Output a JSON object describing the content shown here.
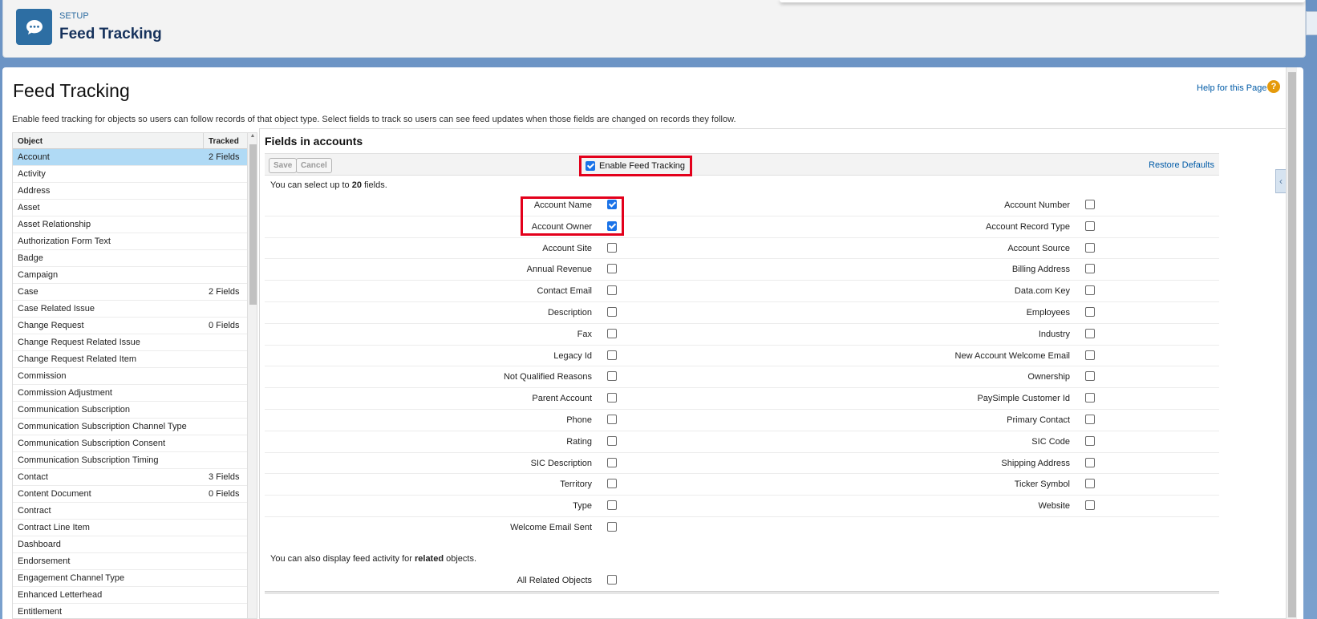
{
  "header": {
    "eyebrow": "SETUP",
    "title": "Feed Tracking",
    "icon": "chat-bubble-icon"
  },
  "page": {
    "title": "Feed Tracking",
    "help_label": "Help for this Page",
    "help_icon": "question-icon",
    "description": "Enable feed tracking for objects so users can follow records of that object type. Select fields to track so users can see feed updates when those fields are changed on records they follow."
  },
  "object_list": {
    "col_object": "Object",
    "col_tracked": "Tracked",
    "rows": [
      {
        "name": "Account",
        "tracked": "2 Fields",
        "selected": true
      },
      {
        "name": "Activity",
        "tracked": ""
      },
      {
        "name": "Address",
        "tracked": ""
      },
      {
        "name": "Asset",
        "tracked": ""
      },
      {
        "name": "Asset Relationship",
        "tracked": ""
      },
      {
        "name": "Authorization Form Text",
        "tracked": ""
      },
      {
        "name": "Badge",
        "tracked": ""
      },
      {
        "name": "Campaign",
        "tracked": ""
      },
      {
        "name": "Case",
        "tracked": "2 Fields"
      },
      {
        "name": "Case Related Issue",
        "tracked": ""
      },
      {
        "name": "Change Request",
        "tracked": "0 Fields"
      },
      {
        "name": "Change Request Related Issue",
        "tracked": ""
      },
      {
        "name": "Change Request Related Item",
        "tracked": ""
      },
      {
        "name": "Commission",
        "tracked": ""
      },
      {
        "name": "Commission Adjustment",
        "tracked": ""
      },
      {
        "name": "Communication Subscription",
        "tracked": ""
      },
      {
        "name": "Communication Subscription Channel Type",
        "tracked": ""
      },
      {
        "name": "Communication Subscription Consent",
        "tracked": ""
      },
      {
        "name": "Communication Subscription Timing",
        "tracked": ""
      },
      {
        "name": "Contact",
        "tracked": "3 Fields"
      },
      {
        "name": "Content Document",
        "tracked": "0 Fields"
      },
      {
        "name": "Contract",
        "tracked": ""
      },
      {
        "name": "Contract Line Item",
        "tracked": ""
      },
      {
        "name": "Dashboard",
        "tracked": ""
      },
      {
        "name": "Endorsement",
        "tracked": ""
      },
      {
        "name": "Engagement Channel Type",
        "tracked": ""
      },
      {
        "name": "Enhanced Letterhead",
        "tracked": ""
      },
      {
        "name": "Entitlement",
        "tracked": ""
      }
    ]
  },
  "fields_panel": {
    "title": "Fields in accounts",
    "save_label": "Save",
    "cancel_label": "Cancel",
    "enable_label": "Enable Feed Tracking",
    "enable_checked": true,
    "restore_label": "Restore Defaults",
    "limit_prefix": "You can select up to ",
    "limit_count": "20",
    "limit_suffix": " fields.",
    "rows": [
      {
        "left": "Account Name",
        "left_checked": true,
        "right": "Account Number",
        "right_checked": false
      },
      {
        "left": "Account Owner",
        "left_checked": true,
        "right": "Account Record Type",
        "right_checked": false
      },
      {
        "left": "Account Site",
        "left_checked": false,
        "right": "Account Source",
        "right_checked": false
      },
      {
        "left": "Annual Revenue",
        "left_checked": false,
        "right": "Billing Address",
        "right_checked": false
      },
      {
        "left": "Contact Email",
        "left_checked": false,
        "right": "Data.com Key",
        "right_checked": false
      },
      {
        "left": "Description",
        "left_checked": false,
        "right": "Employees",
        "right_checked": false
      },
      {
        "left": "Fax",
        "left_checked": false,
        "right": "Industry",
        "right_checked": false
      },
      {
        "left": "Legacy Id",
        "left_checked": false,
        "right": "New Account Welcome Email",
        "right_checked": false
      },
      {
        "left": "Not Qualified Reasons",
        "left_checked": false,
        "right": "Ownership",
        "right_checked": false
      },
      {
        "left": "Parent Account",
        "left_checked": false,
        "right": "PaySimple Customer Id",
        "right_checked": false
      },
      {
        "left": "Phone",
        "left_checked": false,
        "right": "Primary Contact",
        "right_checked": false
      },
      {
        "left": "Rating",
        "left_checked": false,
        "right": "SIC Code",
        "right_checked": false
      },
      {
        "left": "SIC Description",
        "left_checked": false,
        "right": "Shipping Address",
        "right_checked": false
      },
      {
        "left": "Territory",
        "left_checked": false,
        "right": "Ticker Symbol",
        "right_checked": false
      },
      {
        "left": "Type",
        "left_checked": false,
        "right": "Website",
        "right_checked": false
      },
      {
        "left": "Welcome Email Sent",
        "left_checked": false,
        "right": "",
        "right_checked": null
      }
    ],
    "related_prefix": "You can also display feed activity for ",
    "related_bold": "related",
    "related_suffix": " objects.",
    "related_label": "All Related Objects",
    "related_checked": false
  },
  "colors": {
    "accent": "#2d6ea3",
    "link": "#015ba7",
    "selected_row": "#b0daf5",
    "highlight": "#e3001b",
    "checkbox_on": "#1a73e8"
  }
}
